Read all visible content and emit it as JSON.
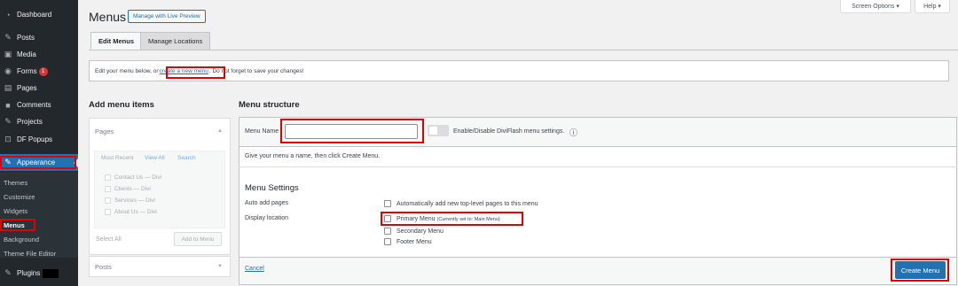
{
  "sidebar": {
    "items": [
      {
        "label": "Dashboard",
        "icon": "dashboard-icon"
      },
      {
        "label": "Posts",
        "icon": "pin-icon"
      },
      {
        "label": "Media",
        "icon": "media-icon"
      },
      {
        "label": "Forms",
        "icon": "forms-icon",
        "badge": "1"
      },
      {
        "label": "Pages",
        "icon": "page-icon"
      },
      {
        "label": "Comments",
        "icon": "comment-icon"
      },
      {
        "label": "Projects",
        "icon": "pin-icon"
      },
      {
        "label": "DF Popups",
        "icon": "popup-icon"
      },
      {
        "label": "Appearance",
        "icon": "brush-icon"
      },
      {
        "label": "Plugins",
        "icon": "plugin-icon"
      }
    ],
    "submenu": [
      "Themes",
      "Customize",
      "Widgets",
      "Menus",
      "Background",
      "Theme File Editor"
    ]
  },
  "top": {
    "screen_options": "Screen Options ▾",
    "help": "Help ▾"
  },
  "header": {
    "title": "Menus",
    "live_preview": "Manage with Live Preview"
  },
  "tabs": [
    "Edit Menus",
    "Manage Locations"
  ],
  "notice": {
    "before": "Edit your menu below, or",
    "link": "create a new menu",
    "after": ". Do not forget to save your changes!"
  },
  "add_items": {
    "heading": "Add menu items",
    "pages_title": "Pages",
    "subtabs": [
      "Most Recent",
      "View All",
      "Search"
    ],
    "pages": [
      "Contact Us — Divi",
      "Clients — Divi",
      "Services — Divi",
      "About Us — Divi"
    ],
    "select_all": "Select All",
    "add_button": "Add to Menu",
    "posts_title": "Posts"
  },
  "structure": {
    "heading": "Menu structure",
    "name_label": "Menu Name",
    "name_value": "",
    "toggle_label": "Enable/Disable DiviFlash menu settings.",
    "hint": "Give your menu a name, then click Create Menu.",
    "settings_title": "Menu Settings",
    "auto_add_label": "Auto add pages",
    "auto_add_option": "Automatically add new top-level pages to this menu",
    "display_label": "Display location",
    "locations": [
      {
        "label": "Primary Menu",
        "note": "(Currently set to: Main Menu)"
      },
      {
        "label": "Secondary Menu",
        "note": ""
      },
      {
        "label": "Footer Menu",
        "note": ""
      }
    ],
    "cancel": "Cancel",
    "create": "Create Menu"
  },
  "colors": {
    "sidebar": "#23282d",
    "accent": "#2271b1",
    "highlight": "#e00000"
  }
}
